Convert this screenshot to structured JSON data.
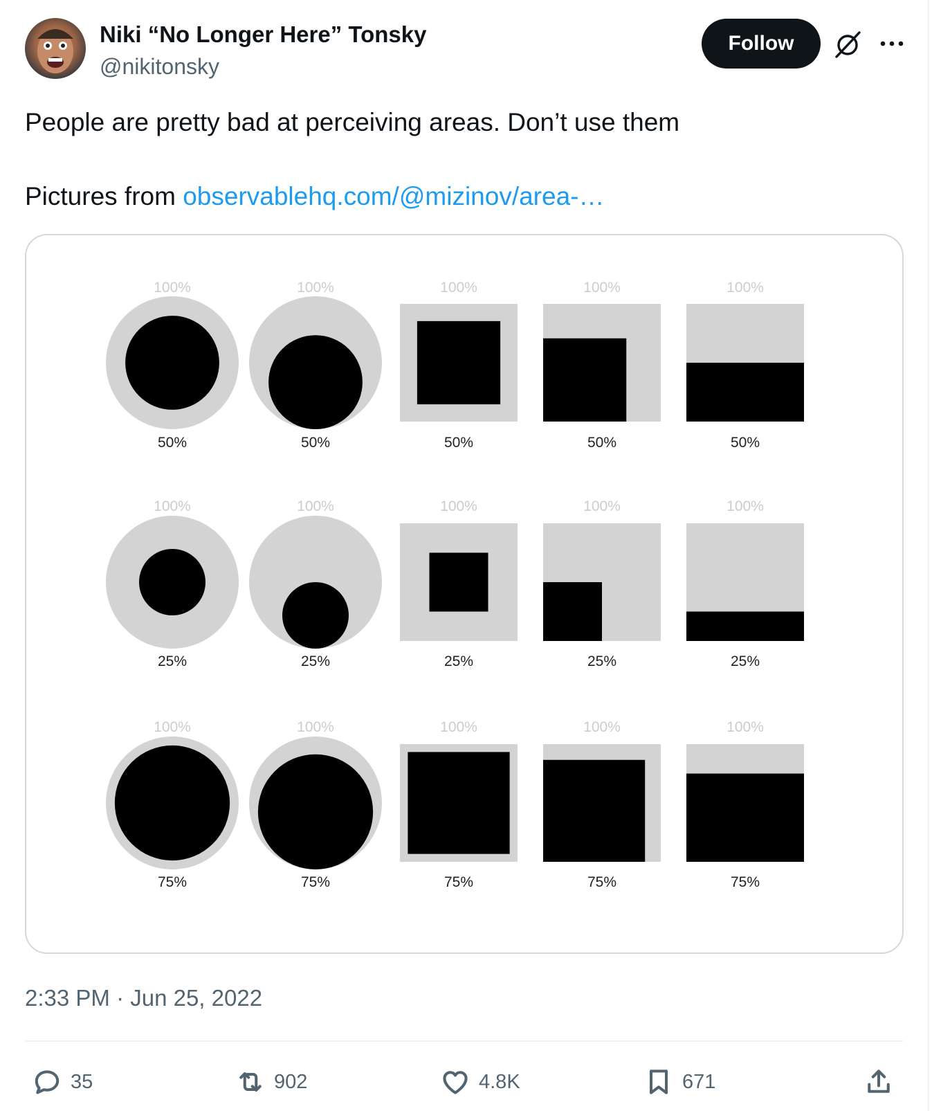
{
  "author": {
    "display_name": "Niki “No Longer Here” Tonsky",
    "handle": "@nikitonsky",
    "follow_label": "Follow"
  },
  "tweet": {
    "text_line1": "People are pretty bad at perceiving areas. Don’t use them",
    "text_prefix": "Pictures from",
    "link_text": "observablehq.com/@mizinov/area-…",
    "timestamp": "2:33 PM · Jun 25, 2022"
  },
  "figure": {
    "reference_label": "100%",
    "shapes": [
      "circle-centered",
      "circle-bottom",
      "square-centered",
      "square-corner",
      "bar-bottom"
    ],
    "rows": [
      {
        "label": "50%",
        "fraction": 0.5
      },
      {
        "label": "25%",
        "fraction": 0.25
      },
      {
        "label": "75%",
        "fraction": 0.75
      }
    ],
    "colors": {
      "reference": "#d3d3d3",
      "value": "#000000",
      "top_label": "#cccccc",
      "bottom_label": "#222222"
    }
  },
  "actions": {
    "replies": "35",
    "retweets": "902",
    "likes": "4.8K",
    "bookmarks": "671"
  },
  "icons": [
    "grok-icon",
    "more-icon",
    "reply-icon",
    "retweet-icon",
    "like-icon",
    "bookmark-icon",
    "share-icon"
  ]
}
